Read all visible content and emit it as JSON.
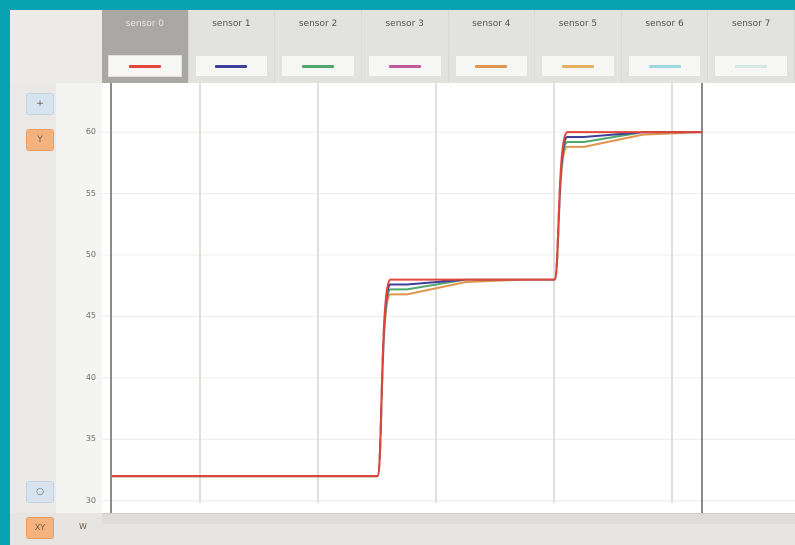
{
  "tabs": [
    {
      "label": "sensor 0",
      "color": "#e2463b"
    },
    {
      "label": "sensor 1",
      "color": "#3f3f9a"
    },
    {
      "label": "sensor 2",
      "color": "#52a86c"
    },
    {
      "label": "sensor 3",
      "color": "#c05a9a"
    },
    {
      "label": "sensor 4",
      "color": "#e0954f"
    },
    {
      "label": "sensor 5",
      "color": "#e6b063"
    },
    {
      "label": "sensor 6",
      "color": "#9fd6e0"
    },
    {
      "label": "sensor 7",
      "color": "#d5e8e4"
    }
  ],
  "left_toolbar": {
    "zoom_in_icon": "plus-icon",
    "y_button_label": "Y",
    "reset_icon": "circle-icon"
  },
  "bottom": {
    "xy_button_label": "XY",
    "x_button_label": "W"
  },
  "y_ticks": [
    "60",
    "55",
    "50",
    "45",
    "40",
    "35",
    "30"
  ],
  "chart_data": {
    "type": "line",
    "x": [
      0,
      10,
      20,
      30,
      40,
      50,
      60,
      70,
      80,
      90,
      100
    ],
    "series": [
      {
        "color": "#e2463b",
        "values": [
          32,
          32,
          32,
          32,
          32,
          48,
          48,
          48,
          60,
          60,
          60
        ]
      },
      {
        "color": "#3f3f9a",
        "values": [
          32,
          32,
          32,
          32,
          32,
          47.6,
          48,
          48,
          59.6,
          60,
          60
        ]
      },
      {
        "color": "#52a86c",
        "values": [
          32,
          32,
          32,
          32,
          32,
          47.2,
          48,
          48,
          59.2,
          60,
          60
        ]
      },
      {
        "color": "#e0954f",
        "values": [
          32,
          32,
          32,
          32,
          32,
          46.8,
          47.8,
          48,
          58.8,
          59.8,
          60
        ]
      }
    ],
    "ylim": [
      29,
      64
    ],
    "grid": true
  }
}
